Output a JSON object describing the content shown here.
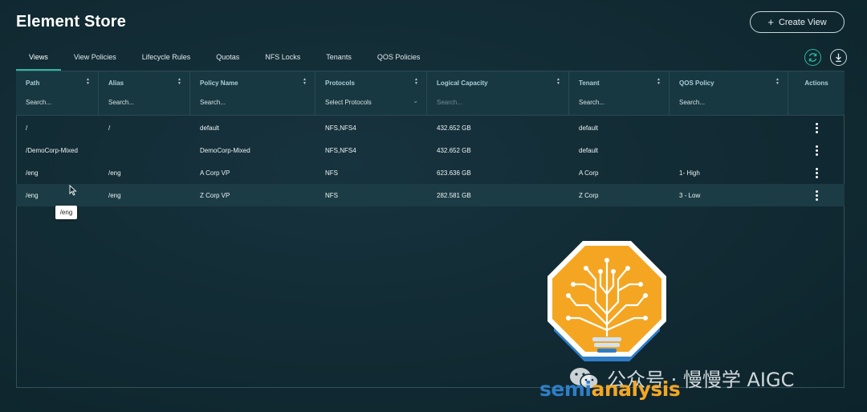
{
  "header": {
    "title": "Element Store",
    "create_label": "Create View"
  },
  "tabs": [
    {
      "label": "Views",
      "active": true
    },
    {
      "label": "View Policies",
      "active": false
    },
    {
      "label": "Lifecycle Rules",
      "active": false
    },
    {
      "label": "Quotas",
      "active": false
    },
    {
      "label": "NFS Locks",
      "active": false
    },
    {
      "label": "Tenants",
      "active": false
    },
    {
      "label": "QOS Policies",
      "active": false
    }
  ],
  "toolbar_icons": [
    "refresh-icon",
    "download-icon"
  ],
  "columns": [
    {
      "label": "Path",
      "search": "Search...",
      "width": 103
    },
    {
      "label": "Alias",
      "search": "Search...",
      "width": 114
    },
    {
      "label": "Policy Name",
      "search": "Search...",
      "width": 156
    },
    {
      "label": "Protocols",
      "search": "Select Protocols",
      "width": 139
    },
    {
      "label": "Logical Capacity",
      "search": "Search...",
      "width": 177
    },
    {
      "label": "Tenant",
      "search": "Search...",
      "width": 125
    },
    {
      "label": "QOS Policy",
      "search": "Search...",
      "width": 148
    },
    {
      "label": "Actions",
      "search": "",
      "width": 70
    }
  ],
  "rows": [
    {
      "path": "/",
      "alias": "/",
      "policy": "default",
      "protocols": "NFS,NFS4",
      "capacity": "432.652 GB",
      "tenant": "default",
      "qos": ""
    },
    {
      "path": "/DemoCorp-Mixed",
      "alias": "",
      "policy": "DemoCorp-Mixed",
      "protocols": "NFS,NFS4",
      "capacity": "432.652 GB",
      "tenant": "default",
      "qos": ""
    },
    {
      "path": "/eng",
      "alias": "/eng",
      "policy": "A Corp VP",
      "protocols": "NFS",
      "capacity": "623.636 GB",
      "tenant": "A Corp",
      "qos": "1- High"
    },
    {
      "path": "/eng",
      "alias": "/eng",
      "policy": "Z Corp VP",
      "protocols": "NFS",
      "capacity": "282.581 GB",
      "tenant": "Z Corp",
      "qos": "3 - Low"
    }
  ],
  "tooltip": "/eng",
  "overlay": {
    "logo_part1": "semi",
    "logo_part2": "analysis",
    "watermark_text": "公众号 · 慢慢学 AIGC"
  },
  "colors": {
    "accent": "#2fb8a3",
    "background": "#112a33",
    "logo_orange": "#f4a623",
    "logo_blue": "#2f7dc6"
  }
}
